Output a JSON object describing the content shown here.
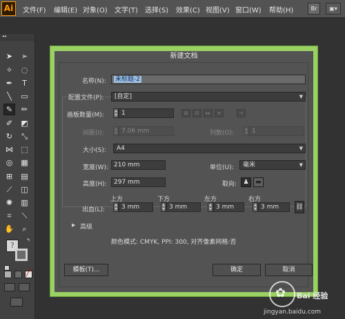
{
  "app": {
    "logo": "Ai"
  },
  "menubar": {
    "items": [
      "文件(F)",
      "编辑(E)",
      "对象(O)",
      "文字(T)",
      "选择(S)",
      "效果(C)",
      "视图(V)",
      "窗口(W)",
      "帮助(H)"
    ],
    "bridge_label": "Br",
    "layout_label": "▣▾"
  },
  "dialog": {
    "title": "新建文档",
    "name_label": "名称(N):",
    "name_value": "未标题-2",
    "profile_label": "配置文件(P):",
    "profile_value": "[自定]",
    "artboards_label": "画板数量(M):",
    "artboards_value": "1",
    "spacing_label": "间距(I):",
    "spacing_value": "7.06 mm",
    "columns_label": "列数(O):",
    "columns_value": "1",
    "size_label": "大小(S):",
    "size_value": "A4",
    "width_label": "宽度(W):",
    "width_value": "210 mm",
    "units_label": "单位(U):",
    "units_value": "毫米",
    "height_label": "高度(H):",
    "height_value": "297 mm",
    "orientation_label": "取向:",
    "bleed_label": "出血(L):",
    "bleed": [
      {
        "label": "上方",
        "value": "3 mm"
      },
      {
        "label": "下方",
        "value": "3 mm"
      },
      {
        "label": "左方",
        "value": "3 mm"
      },
      {
        "label": "右方",
        "value": "3 mm"
      }
    ],
    "advanced_label": "高级",
    "info_text": "颜色模式: CMYK, PPI: 300, 对齐像素网格:否",
    "templates_button": "模板(T)...",
    "ok_button": "确定",
    "cancel_button": "取消"
  },
  "watermark": {
    "text": "Bai 经验",
    "url": "jingyan.baidu.com"
  },
  "colors": {
    "frame_highlight": "#9bd063",
    "ui_bg": "#535353",
    "logo_orange": "#ff9a00"
  }
}
